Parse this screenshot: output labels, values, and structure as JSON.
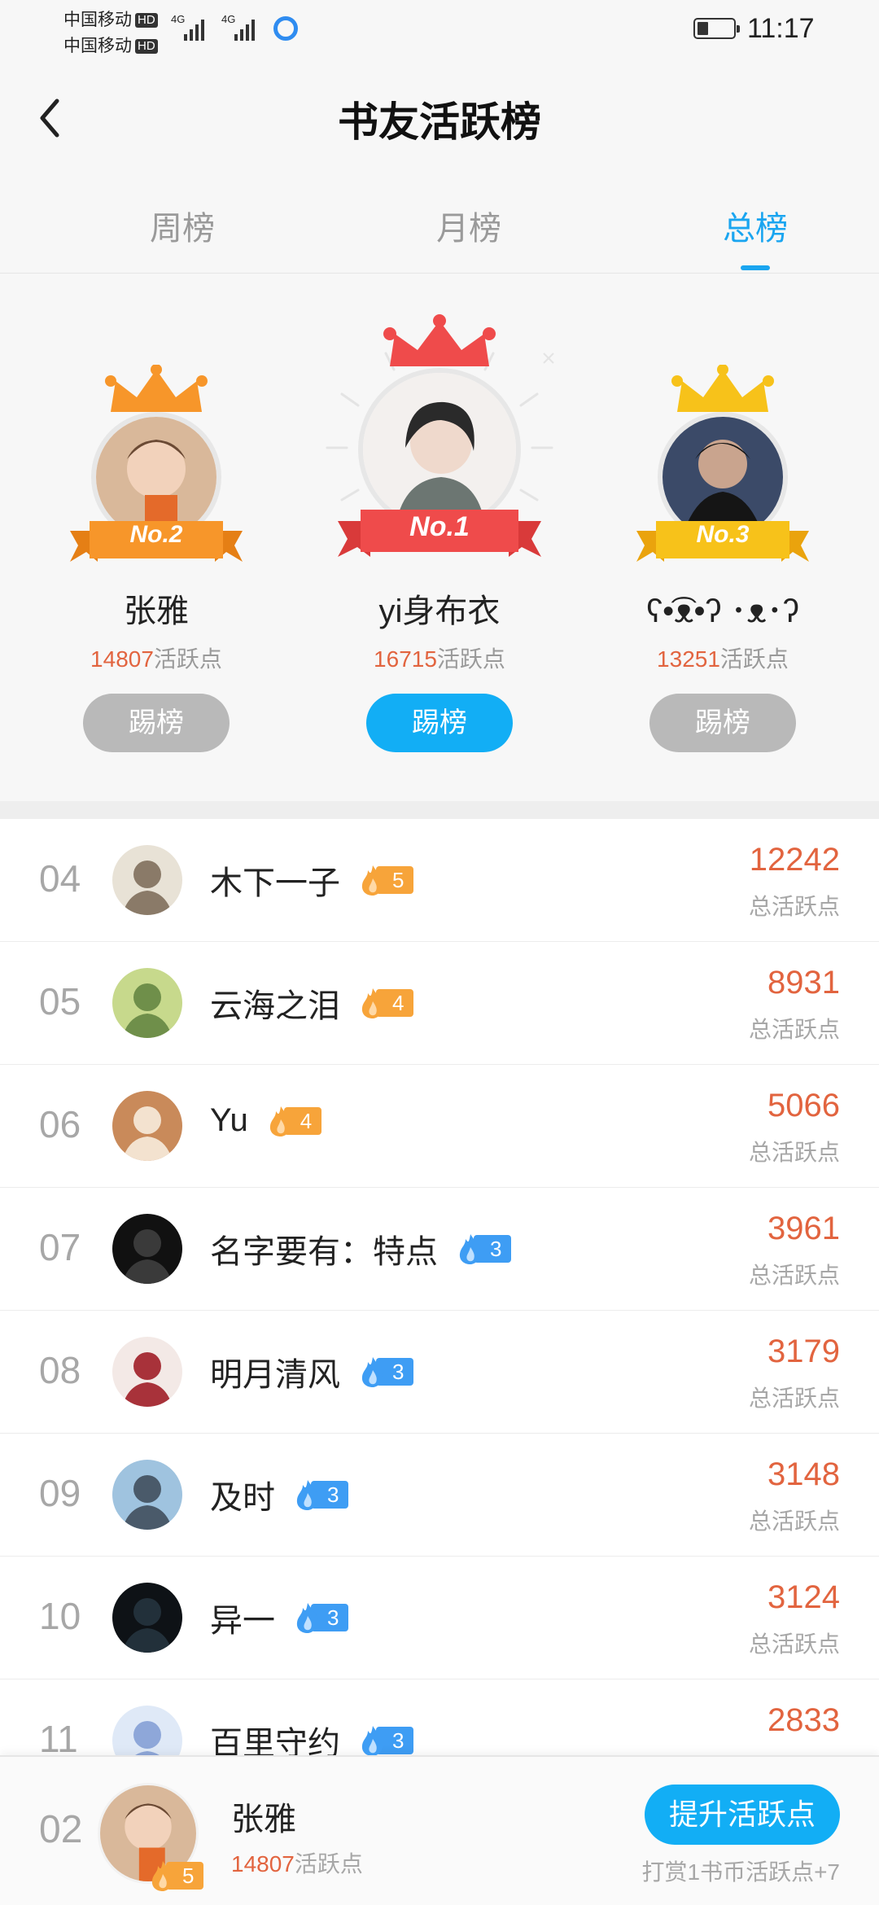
{
  "status_bar": {
    "carrier1": "中国移动",
    "carrier2": "中国移动",
    "hd": "HD",
    "network": "4G",
    "time": "11:17"
  },
  "header": {
    "title": "书友活跃榜"
  },
  "tabs": [
    {
      "label": "周榜",
      "active": false
    },
    {
      "label": "月榜",
      "active": false
    },
    {
      "label": "总榜",
      "active": true
    }
  ],
  "podium": {
    "points_unit": "活跃点",
    "kick_label": "踢榜",
    "first": {
      "badge": "No.1",
      "name": "yi身布衣",
      "points": "16715"
    },
    "second": {
      "badge": "No.2",
      "name": "张雅",
      "points": "14807"
    },
    "third": {
      "badge": "No.3",
      "name": "ʕ•͡ᴥ•ʔ ･ᴥ･ʔ",
      "points": "13251"
    }
  },
  "ranking": {
    "score_label": "总活跃点",
    "rows": [
      {
        "rank": "04",
        "name": "木下一子",
        "level": "5",
        "level_color": "orange",
        "score": "12242"
      },
      {
        "rank": "05",
        "name": "云海之泪",
        "level": "4",
        "level_color": "orange",
        "score": "8931"
      },
      {
        "rank": "06",
        "name": "Yu",
        "level": "4",
        "level_color": "orange",
        "score": "5066"
      },
      {
        "rank": "07",
        "name": "名字要有：特点",
        "level": "3",
        "level_color": "blue",
        "score": "3961"
      },
      {
        "rank": "08",
        "name": "明月清风",
        "level": "3",
        "level_color": "blue",
        "score": "3179"
      },
      {
        "rank": "09",
        "name": "及时",
        "level": "3",
        "level_color": "blue",
        "score": "3148"
      },
      {
        "rank": "10",
        "name": "异一",
        "level": "3",
        "level_color": "blue",
        "score": "3124"
      },
      {
        "rank": "11",
        "name": "百里守约",
        "level": "3",
        "level_color": "blue",
        "score": "2833"
      }
    ]
  },
  "my_rank": {
    "rank": "02",
    "name": "张雅",
    "level": "5",
    "points": "14807",
    "points_unit": "活跃点",
    "boost_label": "提升活跃点",
    "hint": "打赏1书币活跃点+7"
  },
  "colors": {
    "accent": "#12aef5",
    "score": "#e2643f",
    "level_orange": "#f7a43a",
    "level_blue": "#3e9df4",
    "crown_first": "#ef4b4b",
    "crown_second": "#f7962a",
    "crown_third": "#f7c21a"
  }
}
